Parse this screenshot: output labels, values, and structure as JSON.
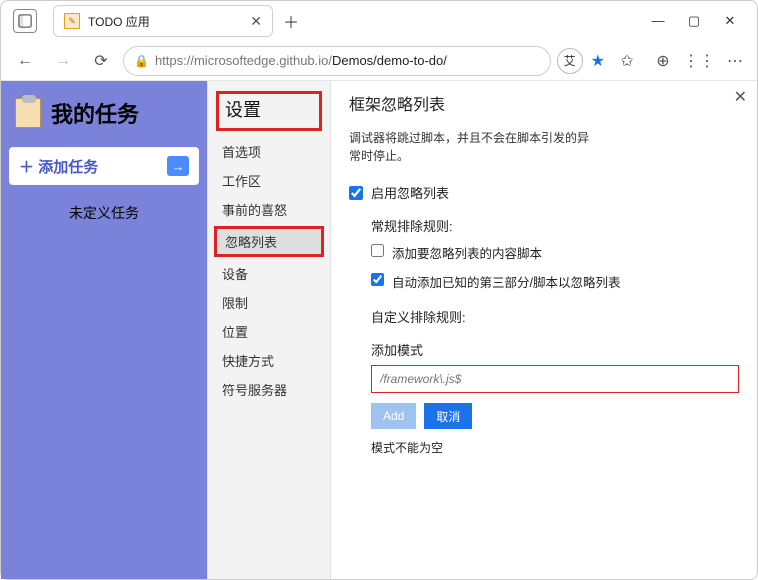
{
  "window": {
    "tab_title": "TODO 应用"
  },
  "addressbar": {
    "prefix": "https://microsoftedge.github.io/",
    "highlighted": "Demos/demo-to-do/"
  },
  "profile_badge": "艾",
  "app": {
    "title": "我的任务",
    "add_task": "添加任务",
    "undefined_task": "未定义任务"
  },
  "settings": {
    "header": "设置",
    "items": [
      "首选项",
      "工作区",
      "事前的喜怒",
      "忽略列表",
      "设备",
      "限制",
      "位置",
      "快捷方式",
      "符号服务器"
    ],
    "selected_index": 3
  },
  "panel": {
    "title": "框架忽略列表",
    "description_line1": "调试器将跳过脚本，并且不会在脚本引发的异",
    "description_line2": "常时停止。",
    "enable_label": "启用忽略列表",
    "general_rules_label": "常规排除规则:",
    "rule1_label": "添加要忽略列表的内容脚本",
    "rule2_label": "自动添加已知的第三部分/脚本以忽略列表",
    "custom_rules_label": "自定义排除规则:",
    "add_pattern_label": "添加模式",
    "pattern_placeholder": "/framework\\.js$",
    "add_btn": "Add",
    "cancel_btn": "取消",
    "error_text": "模式不能为空"
  }
}
